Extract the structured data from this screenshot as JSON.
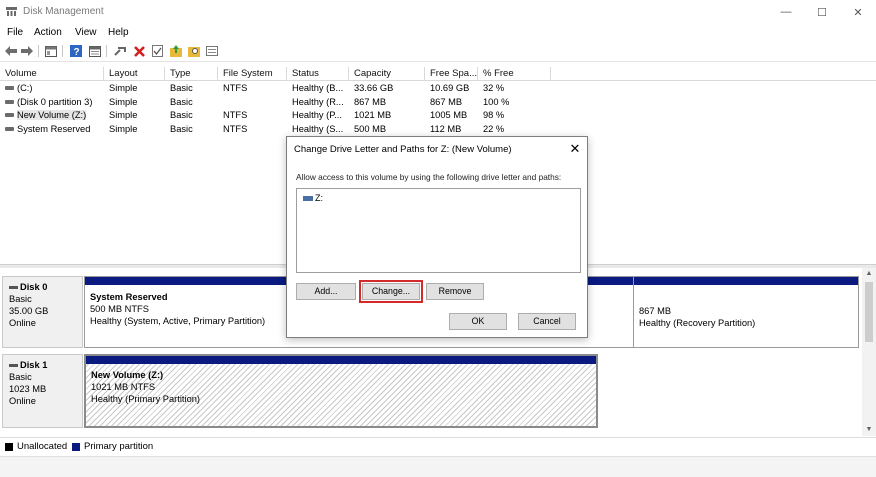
{
  "window": {
    "title": "Disk Management",
    "minimize_glyph": "—",
    "maximize_glyph": "☐",
    "close_glyph": "✕"
  },
  "menu": [
    "File",
    "Action",
    "View",
    "Help"
  ],
  "toolbar": {
    "icons": [
      "back-arrow-icon",
      "forward-arrow-icon",
      "console-icon",
      "help-icon",
      "properties-icon",
      "connect-icon",
      "delete-icon",
      "check-icon",
      "folder-up-icon",
      "folder-search-icon",
      "list-view-icon"
    ]
  },
  "volume_list": {
    "columns": [
      "Volume",
      "Layout",
      "Type",
      "File System",
      "Status",
      "Capacity",
      "Free Spa...",
      "% Free"
    ],
    "rows": [
      {
        "volume": "(C:)",
        "layout": "Simple",
        "type": "Basic",
        "fs": "NTFS",
        "status": "Healthy (B...",
        "capacity": "33.66 GB",
        "free": "10.69 GB",
        "pct": "32 %"
      },
      {
        "volume": "(Disk 0 partition 3)",
        "layout": "Simple",
        "type": "Basic",
        "fs": "",
        "status": "Healthy (R...",
        "capacity": "867 MB",
        "free": "867 MB",
        "pct": "100 %"
      },
      {
        "volume": "New Volume (Z:)",
        "layout": "Simple",
        "type": "Basic",
        "fs": "NTFS",
        "status": "Healthy (P...",
        "capacity": "1021 MB",
        "free": "1005 MB",
        "pct": "98 %"
      },
      {
        "volume": "System Reserved",
        "layout": "Simple",
        "type": "Basic",
        "fs": "NTFS",
        "status": "Healthy (S...",
        "capacity": "500 MB",
        "free": "112 MB",
        "pct": "22 %"
      }
    ]
  },
  "disks": [
    {
      "name": "Disk 0",
      "type": "Basic",
      "size": "35.00 GB",
      "state": "Online",
      "partitions": [
        {
          "name": "System Reserved",
          "size": "500 MB NTFS",
          "status": "Healthy (System, Active, Primary Partition)"
        },
        {
          "name": "",
          "size": "867 MB",
          "status": "Healthy (Recovery Partition)"
        }
      ]
    },
    {
      "name": "Disk 1",
      "type": "Basic",
      "size": "1023 MB",
      "state": "Online",
      "partitions": [
        {
          "name": "New Volume  (Z:)",
          "size": "1021 MB NTFS",
          "status": "Healthy (Primary Partition)"
        }
      ]
    }
  ],
  "legend": [
    {
      "label": "Unallocated",
      "color": "#000000"
    },
    {
      "label": "Primary partition",
      "color": "#0a1a80"
    }
  ],
  "dialog": {
    "title": "Change Drive Letter and Paths for Z: (New Volume)",
    "close_glyph": "✕",
    "instruction": "Allow access to this volume by using the following drive letter and paths:",
    "paths": [
      "Z:"
    ],
    "buttons": {
      "add": "Add...",
      "change": "Change...",
      "remove": "Remove",
      "ok": "OK",
      "cancel": "Cancel"
    }
  },
  "colors": {
    "accent_bar": "#0a1a80",
    "highlight": "#d42a2a"
  }
}
